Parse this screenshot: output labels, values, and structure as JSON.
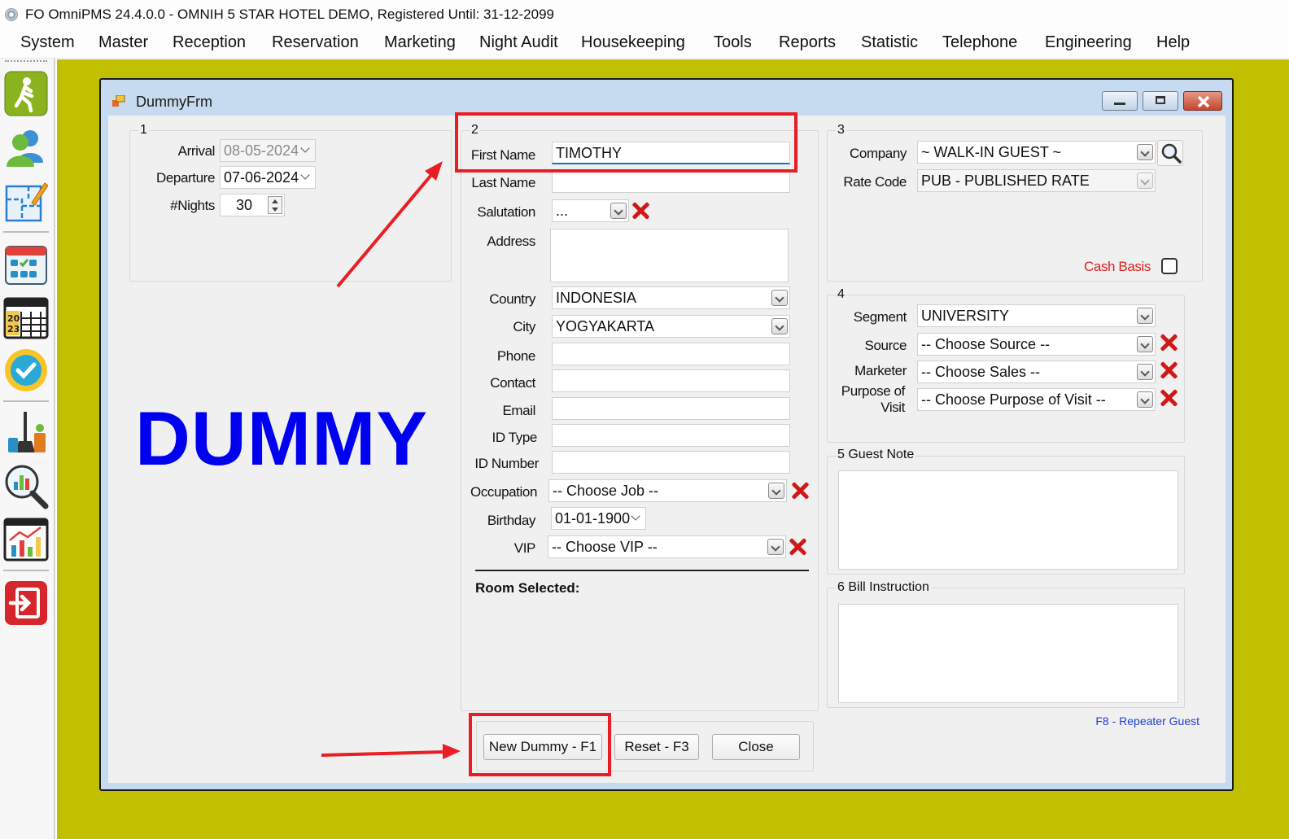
{
  "window_title": "FO OmniPMS 24.4.0.0 - OMNIH 5 STAR HOTEL DEMO, Registered Until: 31-12-2099",
  "menu": [
    "System",
    "Master",
    "Reception",
    "Reservation",
    "Marketing",
    "Night Audit",
    "Housekeeping",
    "Tools",
    "Reports",
    "Statistic",
    "Telephone",
    "Engineering",
    "Help"
  ],
  "toolbar_icons": [
    "walk-in-icon",
    "guests-icon",
    "floor-plan-icon",
    "calendar-grid-icon",
    "calendar-2023-icon",
    "availability-icon",
    "housekeeping-icon",
    "search-analytics-icon",
    "statistics-chart-icon",
    "exit-icon"
  ],
  "form": {
    "title": "DummyFrm",
    "watermark": "DUMMY",
    "group1": {
      "caption": "1",
      "arrival_label": "Arrival",
      "arrival_value": "08-05-2024",
      "departure_label": "Departure",
      "departure_value": "07-06-2024",
      "nights_label": "#Nights",
      "nights_value": "30"
    },
    "group2": {
      "caption": "2",
      "first_name_label": "First Name",
      "first_name_value": "TIMOTHY",
      "last_name_label": "Last Name",
      "last_name_value": "",
      "salutation_label": "Salutation",
      "salutation_value": "...",
      "address_label": "Address",
      "address_value": "",
      "country_label": "Country",
      "country_value": "INDONESIA",
      "city_label": "City",
      "city_value": "YOGYAKARTA",
      "phone_label": "Phone",
      "phone_value": "",
      "contact_label": "Contact",
      "contact_value": "",
      "email_label": "Email",
      "email_value": "",
      "id_type_label": "ID Type",
      "id_type_value": "",
      "id_number_label": "ID Number",
      "id_number_value": "",
      "occupation_label": "Occupation",
      "occupation_value": "-- Choose Job --",
      "birthday_label": "Birthday",
      "birthday_value": "01-01-1900",
      "vip_label": "VIP",
      "vip_value": "-- Choose VIP --",
      "room_selected_label": "Room Selected:"
    },
    "group3": {
      "caption": "3",
      "company_label": "Company",
      "company_value": "~ WALK-IN GUEST ~",
      "rate_code_label": "Rate Code",
      "rate_code_value": "PUB - PUBLISHED RATE",
      "cash_basis_label": "Cash Basis",
      "cash_basis_checked": false
    },
    "group4": {
      "caption": "4",
      "segment_label": "Segment",
      "segment_value": "UNIVERSITY",
      "source_label": "Source",
      "source_value": "-- Choose Source --",
      "marketer_label": "Marketer",
      "marketer_value": "-- Choose Sales --",
      "purpose_label_1": "Purpose of",
      "purpose_label_2": "Visit",
      "purpose_value": "-- Choose Purpose of Visit --"
    },
    "group5": {
      "caption": "5 Guest Note",
      "value": ""
    },
    "group6": {
      "caption": "6 Bill Instruction",
      "value": ""
    },
    "repeater_hint": "F8 - Repeater Guest",
    "buttons": {
      "new_dummy": "New Dummy - F1",
      "reset": "Reset - F3",
      "close": "Close"
    }
  },
  "colors": {
    "workspace": "#c0c000",
    "watermark": "#0000f0",
    "annotation": "#ea1c24",
    "cash_basis": "#e02020",
    "hint": "#1a3fd0"
  }
}
